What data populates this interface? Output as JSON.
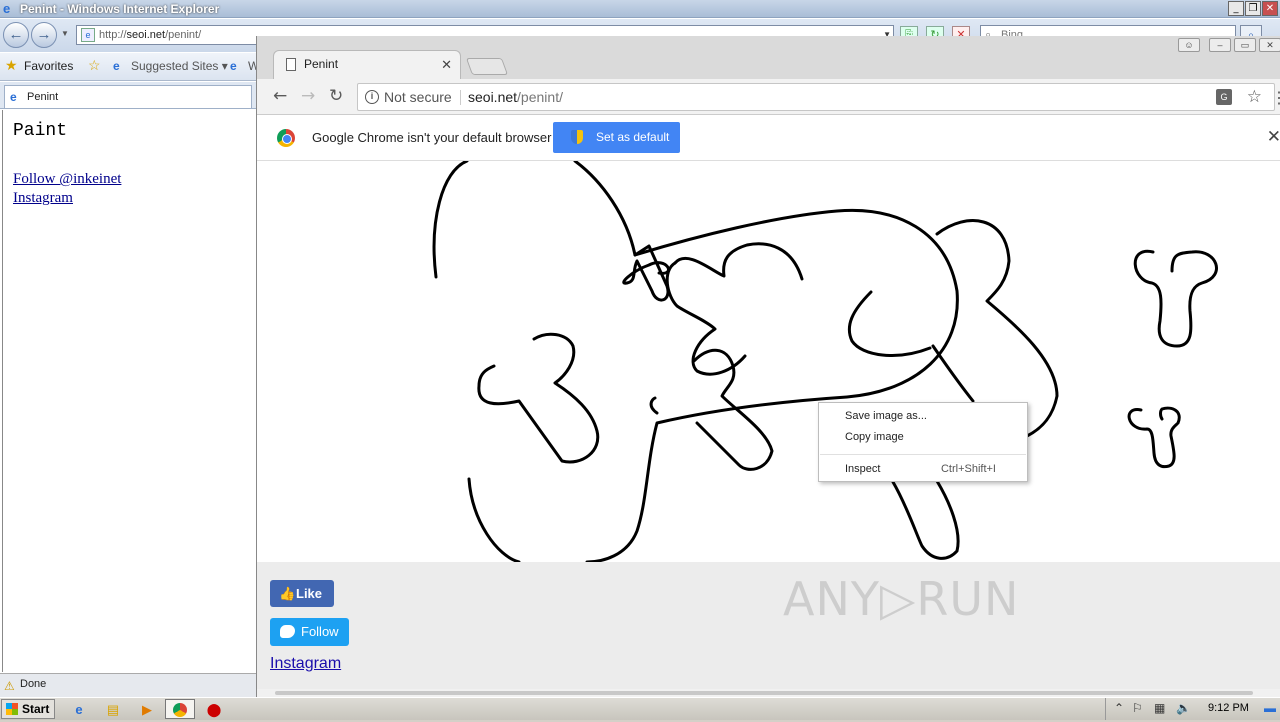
{
  "ie": {
    "title": "Penint - Windows Internet Explorer",
    "address_prefix": "http://",
    "address_host": "seoi.net",
    "address_path": "/penint/",
    "search_placeholder": "Bing",
    "favorites_label": "Favorites",
    "suggested_sites_label": "Suggested Sites ▾",
    "web_slice_label": "W",
    "tab_label": "Penint",
    "page_title": "Paint",
    "links": [
      "Follow @inkeinet",
      "Instagram"
    ],
    "status": "Done"
  },
  "chrome": {
    "tab_title": "Penint",
    "security_label": "Not secure",
    "url_host": "seoi.net",
    "url_path": "/penint/",
    "infobar_message": "Google Chrome isn't your default browser",
    "set_default_label": "Set as default",
    "footer": {
      "like_label": "Like",
      "follow_label": "Follow",
      "instagram_label": "Instagram"
    },
    "context_menu": {
      "items": [
        "Save image as...",
        "Copy image",
        "Inspect"
      ],
      "inspect_shortcut": "Ctrl+Shift+I"
    }
  },
  "watermark": "ANY▷RUN",
  "taskbar": {
    "start_label": "Start",
    "clock": "9:12 PM"
  },
  "colors": {
    "chrome_blue": "#4285f4",
    "facebook": "#4267b2",
    "twitter": "#1da1f2"
  }
}
